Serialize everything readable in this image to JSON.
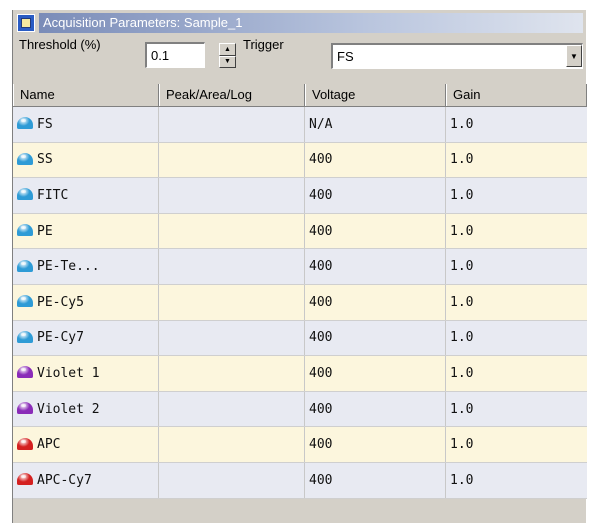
{
  "window": {
    "title": "Acquisition Parameters: Sample_1"
  },
  "controls": {
    "threshold_label": "Threshold (%)",
    "threshold_value": "0.1",
    "trigger_label": "Trigger",
    "trigger_value": "FS"
  },
  "table": {
    "columns": [
      "Name",
      "Peak/Area/Log",
      "Voltage",
      "Gain"
    ],
    "rows": [
      {
        "name": "FS",
        "peak": "",
        "voltage": "N/A",
        "gain": "1.0",
        "color": "#2e9bd6"
      },
      {
        "name": "SS",
        "peak": "",
        "voltage": "400",
        "gain": "1.0",
        "color": "#2e9bd6"
      },
      {
        "name": "FITC",
        "peak": "",
        "voltage": "400",
        "gain": "1.0",
        "color": "#2e9bd6"
      },
      {
        "name": "PE",
        "peak": "",
        "voltage": "400",
        "gain": "1.0",
        "color": "#2e9bd6"
      },
      {
        "name": "PE-Te...",
        "peak": "",
        "voltage": "400",
        "gain": "1.0",
        "color": "#2e9bd6"
      },
      {
        "name": "PE-Cy5",
        "peak": "",
        "voltage": "400",
        "gain": "1.0",
        "color": "#2e9bd6"
      },
      {
        "name": "PE-Cy7",
        "peak": "",
        "voltage": "400",
        "gain": "1.0",
        "color": "#2e9bd6"
      },
      {
        "name": "Violet 1",
        "peak": "",
        "voltage": "400",
        "gain": "1.0",
        "color": "#8a2bb8"
      },
      {
        "name": "Violet 2",
        "peak": "",
        "voltage": "400",
        "gain": "1.0",
        "color": "#8a2bb8"
      },
      {
        "name": "APC",
        "peak": "",
        "voltage": "400",
        "gain": "1.0",
        "color": "#d42020"
      },
      {
        "name": "APC-Cy7",
        "peak": "",
        "voltage": "400",
        "gain": "1.0",
        "color": "#d42020"
      }
    ]
  }
}
